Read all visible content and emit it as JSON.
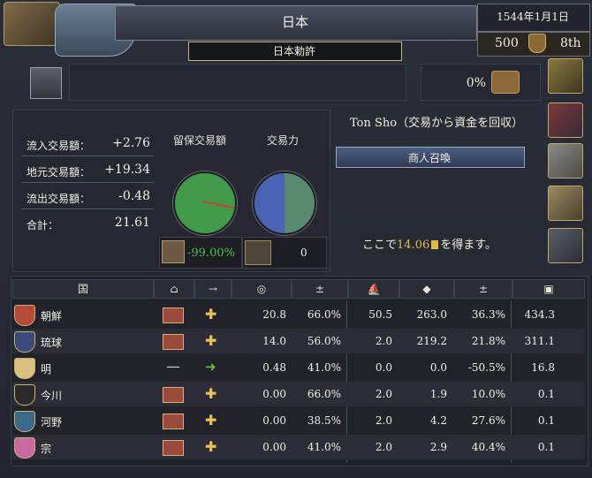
{
  "window": {
    "title": "日本",
    "subtitle": "日本勅許"
  },
  "top_right": {
    "date": "1544年1月1日",
    "score": "500",
    "rank": "8th"
  },
  "mid": {
    "percent": "0%"
  },
  "stats": {
    "incoming_label": "流入交易額：",
    "incoming_value": "+2.76",
    "local_label": "地元交易額：",
    "local_value": "+19.34",
    "outgoing_label": "流出交易額：",
    "outgoing_value": "-0.48",
    "total_label": "合計：",
    "total_value": "21.61"
  },
  "center": {
    "retained_label": "留保交易額",
    "power_label": "交易力",
    "pirate_pct": "-99.00%",
    "ships_value": "0"
  },
  "right": {
    "description": "Ton Sho（交易から資金を回収）",
    "merchant_button": "商人召喚",
    "gain_prefix": "ここで",
    "gain_value": "14.06",
    "gain_suffix": "を得ます。"
  },
  "table": {
    "header_country": "国",
    "rows": [
      {
        "name": "朝鮮",
        "flag_color": "#b84a3a",
        "col1": "house",
        "col2": "plus",
        "v1": "20.8",
        "v2": "66.0%",
        "v3": "50.5",
        "v4": "263.0",
        "v5": "36.3%",
        "v6": "434.3"
      },
      {
        "name": "琉球",
        "flag_color": "#3a4a7a",
        "col1": "house",
        "col2": "plus",
        "v1": "14.0",
        "v2": "56.0%",
        "v3": "2.0",
        "v4": "219.2",
        "v5": "21.8%",
        "v6": "311.1"
      },
      {
        "name": "明",
        "flag_color": "#d8c080",
        "col1": "minus",
        "col2": "arrow",
        "v1": "0.48",
        "v2": "41.0%",
        "v3": "0.0",
        "v4": "0.0",
        "v5": "-50.5%",
        "v6": "16.8"
      },
      {
        "name": "今川",
        "flag_color": "#2a2a2a",
        "col1": "house",
        "col2": "plus",
        "v1": "0.00",
        "v2": "66.0%",
        "v3": "2.0",
        "v4": "1.9",
        "v5": "10.0%",
        "v6": "0.1"
      },
      {
        "name": "河野",
        "flag_color": "#3a6a8a",
        "col1": "house",
        "col2": "plus",
        "v1": "0.00",
        "v2": "38.5%",
        "v3": "2.0",
        "v4": "4.2",
        "v5": "27.6%",
        "v6": "0.1"
      },
      {
        "name": "宗",
        "flag_color": "#c86aa0",
        "col1": "house",
        "col2": "plus",
        "v1": "0.00",
        "v2": "41.0%",
        "v3": "2.0",
        "v4": "2.9",
        "v5": "40.4%",
        "v6": "0.1"
      }
    ]
  },
  "icons": {
    "side_buttons": [
      "trade-goods-icon",
      "merchants-icon",
      "building-icon",
      "city-icon",
      "compass-icon"
    ]
  }
}
